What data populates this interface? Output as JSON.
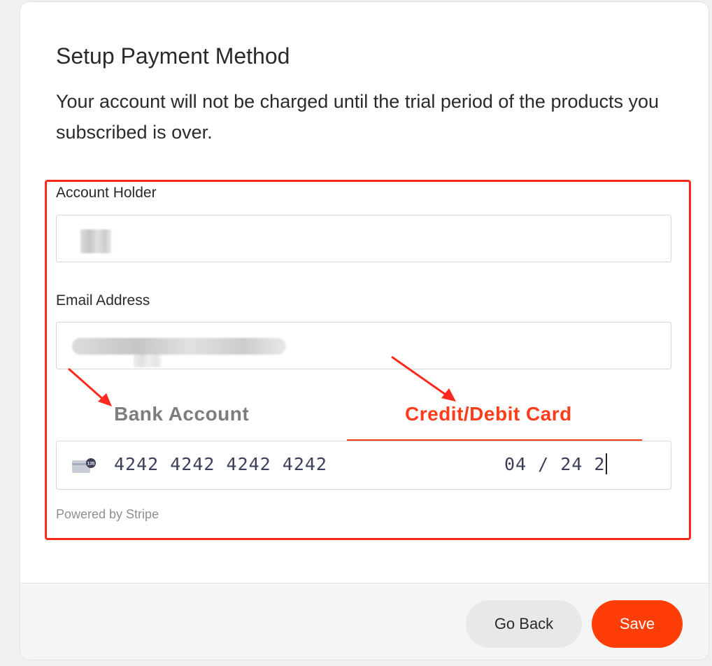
{
  "form": {
    "title": "Setup Payment Method",
    "description": "Your account will not be charged until the trial period of the products you subscribed is over."
  },
  "fields": {
    "account_holder_label": "Account Holder",
    "email_label": "Email Address"
  },
  "tabs": {
    "bank": "Bank Account",
    "card": "Credit/Debit Card",
    "active": "card"
  },
  "card": {
    "number": "4242 4242 4242 4242",
    "expiry": "04 / 24 2",
    "icon_badge": "135"
  },
  "powered_by": "Powered by Stripe",
  "footer": {
    "back_label": "Go Back",
    "save_label": "Save"
  },
  "colors": {
    "accent": "#ff3d1a",
    "annotation": "#ff2a1d",
    "save_button": "#ff3d06"
  }
}
